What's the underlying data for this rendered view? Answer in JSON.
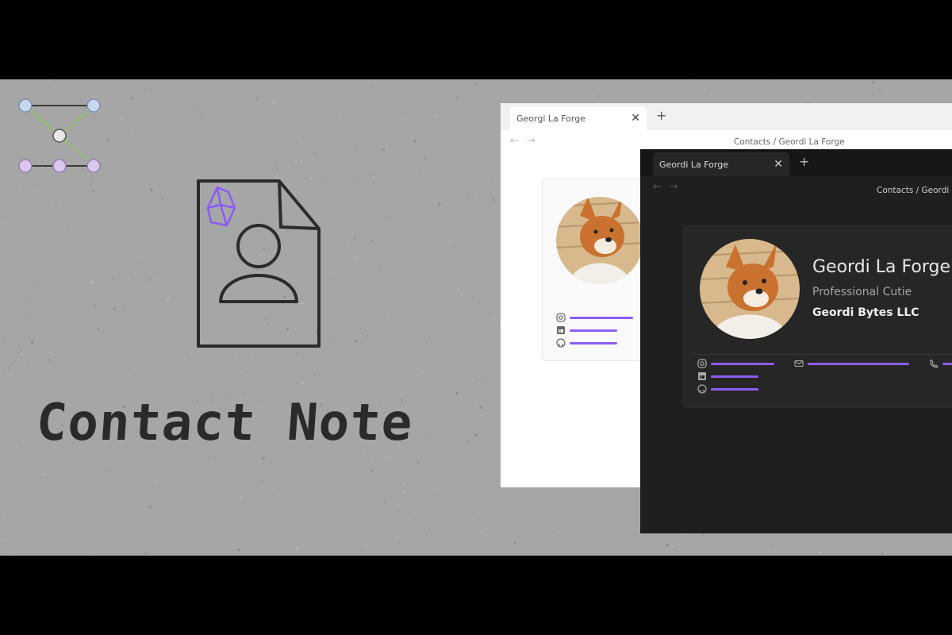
{
  "hero": {
    "title": "Contact Note"
  },
  "colors": {
    "accent_purple": "#8b5cf6",
    "stage_gray": "#a6a6a6",
    "dark_bg": "#1f1f1f",
    "light_bg": "#ffffff",
    "node_blue": "#c7d7f0",
    "node_purple": "#dcc7ec",
    "node_white": "#e8e8e8",
    "edge_green": "#8fc36a"
  },
  "light_window": {
    "tab_title": "Georgi La Forge",
    "close_icon": "close-icon",
    "new_tab_icon": "plus-icon",
    "breadcrumb": "Contacts / Geordi La Forge",
    "social_icons": [
      "instagram-icon",
      "linkedin-icon",
      "github-icon"
    ]
  },
  "dark_window": {
    "tab_title": "Geordi La Forge",
    "breadcrumb": "Contacts / Geordi",
    "contact": {
      "name": "Geordi La Forge",
      "role": "Professional Cutie",
      "company": "Geordi Bytes LLC"
    },
    "social_icons": [
      "instagram-icon",
      "linkedin-icon",
      "github-icon",
      "email-icon",
      "phone-icon"
    ]
  }
}
